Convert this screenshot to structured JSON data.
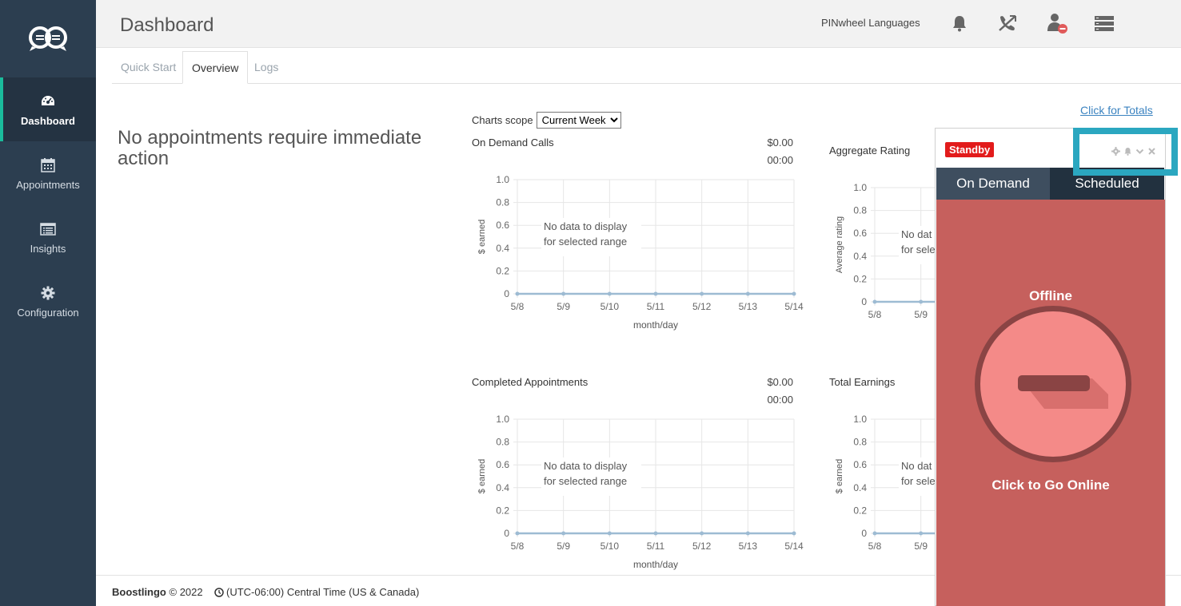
{
  "sidebar": {
    "items": [
      {
        "label": "Dashboard"
      },
      {
        "label": "Appointments"
      },
      {
        "label": "Insights"
      },
      {
        "label": "Configuration"
      }
    ]
  },
  "header": {
    "title": "Dashboard",
    "org": "PINwheel Languages"
  },
  "tabs": [
    {
      "label": "Quick Start"
    },
    {
      "label": "Overview"
    },
    {
      "label": "Logs"
    }
  ],
  "main": {
    "no_appointments": "No appointments require immediate action",
    "click_totals": "Click for Totals",
    "scope_label": "Charts scope",
    "scope_selected": "Current Week",
    "no_data_line1": "No data to display",
    "no_data_line2": "for selected range",
    "no_data_clipped_line1": "No dat",
    "no_data_clipped_line2": "for sele"
  },
  "charts_text": {
    "on_demand": {
      "title": "On Demand Calls",
      "amount": "$0.00",
      "time": "00:00"
    },
    "aggregate": {
      "title": "Aggregate Rating"
    },
    "completed": {
      "title": "Completed Appointments",
      "amount": "$0.00",
      "time": "00:00"
    },
    "total_earnings": {
      "title": "Total Earnings"
    }
  },
  "chart_data": [
    {
      "type": "line",
      "title": "On Demand Calls",
      "xlabel": "month/day",
      "ylabel": "$ earned",
      "x": [
        "5/8",
        "5/9",
        "5/10",
        "5/11",
        "5/12",
        "5/13",
        "5/14"
      ],
      "y": [
        0,
        0,
        0,
        0,
        0,
        0,
        0
      ],
      "ylim": [
        0,
        1.0
      ],
      "yticks": [
        "0",
        "0.2",
        "0.4",
        "0.6",
        "0.8",
        "1.0"
      ],
      "grid": true
    },
    {
      "type": "line",
      "title": "Aggregate Rating",
      "xlabel": "",
      "ylabel": "Average rating",
      "x": [
        "5/8",
        "5/9"
      ],
      "y": [
        0,
        0
      ],
      "ylim": [
        0,
        1.0
      ],
      "yticks": [
        "0",
        "0.2",
        "0.4",
        "0.6",
        "0.8",
        "1.0"
      ],
      "grid": true
    },
    {
      "type": "line",
      "title": "Completed Appointments",
      "xlabel": "month/day",
      "ylabel": "$ earned",
      "x": [
        "5/8",
        "5/9",
        "5/10",
        "5/11",
        "5/12",
        "5/13",
        "5/14"
      ],
      "y": [
        0,
        0,
        0,
        0,
        0,
        0,
        0
      ],
      "ylim": [
        0,
        1.0
      ],
      "yticks": [
        "0",
        "0.2",
        "0.4",
        "0.6",
        "0.8",
        "1.0"
      ],
      "grid": true
    },
    {
      "type": "line",
      "title": "Total Earnings",
      "xlabel": "",
      "ylabel": "$ earned",
      "x": [
        "5/8",
        "5/9"
      ],
      "y": [
        0,
        0
      ],
      "ylim": [
        0,
        1.0
      ],
      "yticks": [
        "0",
        "0.2",
        "0.4",
        "0.6",
        "0.8",
        "1.0"
      ],
      "grid": true
    }
  ],
  "panel": {
    "status_badge": "Standby",
    "tab_on_demand": "On Demand",
    "tab_scheduled": "Scheduled",
    "state": "Offline",
    "action": "Click to Go Online"
  },
  "footer": {
    "brand": "Boostlingo",
    "copyright": "© 2022",
    "timezone": "(UTC-06:00) Central Time (US & Canada)"
  },
  "colors": {
    "sidebar": "#2c3e50",
    "accent": "#1abc9c",
    "link": "#3b83c0",
    "standby_red": "#e21b1b",
    "panel_body": "#c6605d",
    "highlight_box": "#2ba7c0",
    "chart_line": "#9dbbd3"
  }
}
